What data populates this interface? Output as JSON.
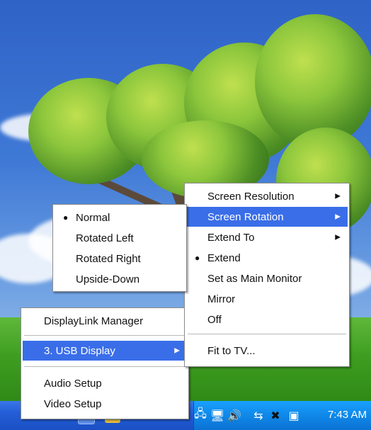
{
  "taskbar": {
    "clock": "7:43 AM",
    "tray_icons": [
      "network-icon",
      "displaylink-icon",
      "volume-icon",
      "usb-icon",
      "safely-remove-icon",
      "monitor-icon"
    ]
  },
  "menus": {
    "main": {
      "items": [
        {
          "label": "DisplayLink Manager"
        },
        {
          "label": "3. USB Display",
          "selected": true,
          "submenu": true
        },
        {
          "label": "Audio Setup"
        },
        {
          "label": "Video Setup"
        }
      ]
    },
    "usb_display": {
      "items": [
        {
          "label": "Screen Resolution",
          "submenu": true
        },
        {
          "label": "Screen Rotation",
          "submenu": true,
          "selected": true
        },
        {
          "label": "Extend To",
          "submenu": true
        },
        {
          "label": "Extend",
          "checked": true
        },
        {
          "label": "Set as Main Monitor"
        },
        {
          "label": "Mirror"
        },
        {
          "label": "Off"
        },
        {
          "label": "Fit to TV..."
        }
      ]
    },
    "rotation": {
      "items": [
        {
          "label": "Normal",
          "checked": true
        },
        {
          "label": "Rotated Left"
        },
        {
          "label": "Rotated Right"
        },
        {
          "label": "Upside-Down"
        }
      ]
    }
  },
  "colors": {
    "menu_highlight": "#3a6ee8",
    "taskbar": "#245ed8",
    "tray": "#0f88e8"
  }
}
